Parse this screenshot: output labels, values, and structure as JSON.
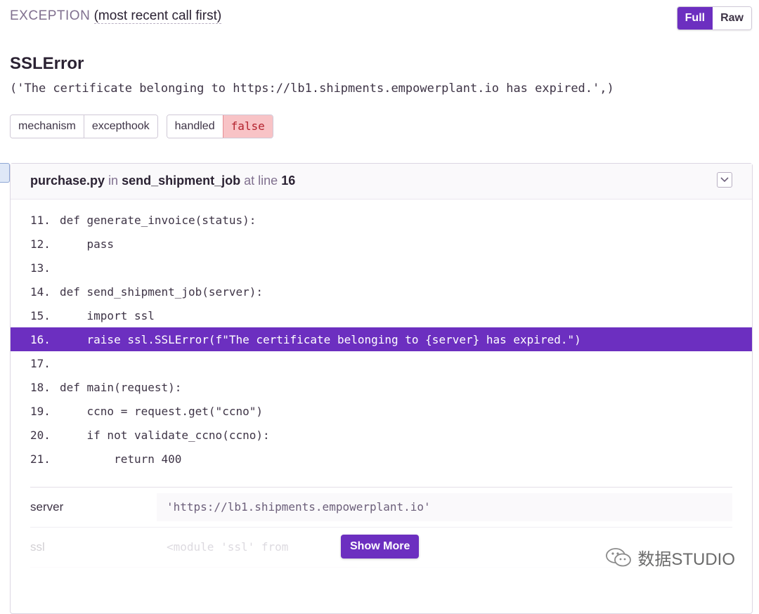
{
  "header": {
    "kind": "EXCEPTION",
    "order": "(most recent call first)",
    "toggle": {
      "full": "Full",
      "raw": "Raw"
    }
  },
  "exception": {
    "type": "SSLError",
    "value": "('The certificate belonging to https://lb1.shipments.empowerplant.io has expired.',)"
  },
  "tags": [
    {
      "key": "mechanism",
      "value": "excepthook"
    },
    {
      "key": "handled",
      "value": "false"
    }
  ],
  "frame": {
    "file": "purchase.py",
    "in_word": "in",
    "function": "send_shipment_job",
    "at_line_word": "at line",
    "line": "16",
    "code": [
      {
        "no": "11.",
        "text": "def generate_invoice(status):"
      },
      {
        "no": "12.",
        "text": "    pass"
      },
      {
        "no": "13.",
        "text": ""
      },
      {
        "no": "14.",
        "text": "def send_shipment_job(server):"
      },
      {
        "no": "15.",
        "text": "    import ssl"
      },
      {
        "no": "16.",
        "text": "    raise ssl.SSLError(f\"The certificate belonging to {server} has expired.\")"
      },
      {
        "no": "17.",
        "text": ""
      },
      {
        "no": "18.",
        "text": "def main(request):"
      },
      {
        "no": "19.",
        "text": "    ccno = request.get(\"ccno\")"
      },
      {
        "no": "20.",
        "text": "    if not validate_ccno(ccno):"
      },
      {
        "no": "21.",
        "text": "        return 400"
      }
    ],
    "vars": [
      {
        "name": "server",
        "value": "'https://lb1.shipments.empowerplant.io'"
      },
      {
        "name": "ssl",
        "value": "<module 'ssl' from"
      }
    ],
    "show_more": "Show More"
  },
  "watermark": {
    "text": "数据STUDIO",
    "icon": "wechat-icon"
  },
  "colors": {
    "accent": "#6c2fc0",
    "false_tag_bg": "#f8c3c6",
    "false_tag_text": "#b3232e"
  }
}
